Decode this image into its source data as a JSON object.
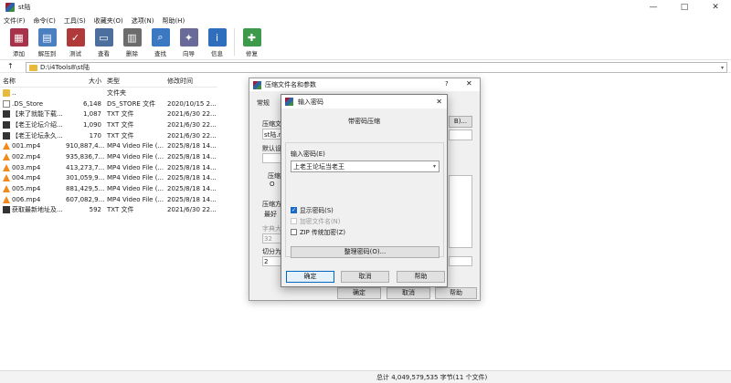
{
  "window": {
    "title": "st陆"
  },
  "window_controls": [
    "—",
    "□",
    "✕"
  ],
  "menu": [
    "文件(F)",
    "命令(C)",
    "工具(S)",
    "收藏夹(O)",
    "选项(N)",
    "帮助(H)"
  ],
  "toolbar": [
    {
      "icon": "add-icon",
      "label": "添加",
      "color": "#a8324a"
    },
    {
      "icon": "extract-icon",
      "label": "解压到",
      "color": "#4a7fc1"
    },
    {
      "icon": "test-icon",
      "label": "测试",
      "color": "#b03a3a"
    },
    {
      "icon": "view-icon",
      "label": "查看",
      "color": "#4d6f9e"
    },
    {
      "icon": "delete-icon",
      "label": "删除",
      "color": "#6c6c6c"
    },
    {
      "icon": "find-icon",
      "label": "查找",
      "color": "#3a78c2"
    },
    {
      "icon": "wizard-icon",
      "label": "向导",
      "color": "#6a6a9a"
    },
    {
      "icon": "info-icon",
      "label": "信息",
      "color": "#2f6dbd"
    },
    {
      "icon": "repair-icon",
      "label": "修复",
      "color": "#3d9a4a"
    }
  ],
  "address": {
    "up": "↑",
    "path": "D:\\i4Tools8\\st陆"
  },
  "columns": {
    "name": "名称",
    "size": "大小",
    "type": "类型",
    "date": "修改时间"
  },
  "files": [
    {
      "icon": "folder",
      "name": "..",
      "size": "",
      "type": "文件夹",
      "date": ""
    },
    {
      "icon": "file",
      "name": ".DS_Store",
      "size": "6,148",
      "type": "DS_STORE 文件",
      "date": "2020/10/15 2..."
    },
    {
      "icon": "txt",
      "name": "【来了就能下载...",
      "size": "1,087",
      "type": "TXT 文件",
      "date": "2021/6/30 22..."
    },
    {
      "icon": "txt",
      "name": "【老王论坛介绍...",
      "size": "1,090",
      "type": "TXT 文件",
      "date": "2021/6/30 22..."
    },
    {
      "icon": "txt",
      "name": "【老王论坛永久...",
      "size": "170",
      "type": "TXT 文件",
      "date": "2021/6/30 22..."
    },
    {
      "icon": "mp4",
      "name": "001.mp4",
      "size": "910,887,4...",
      "type": "MP4 Video File (...",
      "date": "2025/8/18 14..."
    },
    {
      "icon": "mp4",
      "name": "002.mp4",
      "size": "935,836,7...",
      "type": "MP4 Video File (...",
      "date": "2025/8/18 14..."
    },
    {
      "icon": "mp4",
      "name": "003.mp4",
      "size": "413,273,7...",
      "type": "MP4 Video File (...",
      "date": "2025/8/18 14..."
    },
    {
      "icon": "mp4",
      "name": "004.mp4",
      "size": "301,059,9...",
      "type": "MP4 Video File (...",
      "date": "2025/8/18 14..."
    },
    {
      "icon": "mp4",
      "name": "005.mp4",
      "size": "881,429,5...",
      "type": "MP4 Video File (...",
      "date": "2025/8/18 14..."
    },
    {
      "icon": "mp4",
      "name": "006.mp4",
      "size": "607,082,9...",
      "type": "MP4 Video File (...",
      "date": "2025/8/18 14..."
    },
    {
      "icon": "txt",
      "name": "获取最新地址及...",
      "size": "592",
      "type": "TXT 文件",
      "date": "2021/6/30 22..."
    }
  ],
  "status": "总计 4,049,579,535 字节(11 个文件)",
  "bg_dialog": {
    "title": "压缩文件名和参数",
    "help": "?",
    "close": "✕",
    "tab": "常规",
    "label1": "压缩文",
    "field1": "st陆.ra",
    "right_btn": "B)...",
    "label2": "默认设",
    "group_label": "压缩",
    "radio_label": "O",
    "label3": "压缩方",
    "value3": "最好",
    "label4": "字典大",
    "value4": "32",
    "label5": "切分为",
    "value5": "2",
    "ok": "确定",
    "cancel": "取消",
    "help_btn": "帮助"
  },
  "pwd_dialog": {
    "title": "输入密码",
    "close": "✕",
    "caption": "带密码压缩",
    "input_label": "输入密码(E)",
    "password": "上老王论坛当老王",
    "chk_show": "显示密码(S)",
    "chk_show_checked": true,
    "chk_encrypt_names": "加密文件名(N)",
    "chk_zip": "ZIP 传统加密(Z)",
    "organize": "整理密码(O)...",
    "ok": "确定",
    "cancel": "取消",
    "help": "帮助"
  }
}
